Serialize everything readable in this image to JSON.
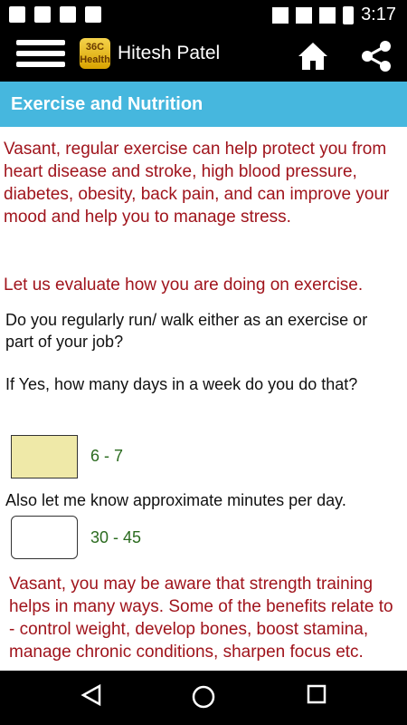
{
  "status_bar": {
    "time": "3:17"
  },
  "app_bar": {
    "logo_text_top": "36C",
    "logo_text_bottom": "Health",
    "title": "Hitesh Patel"
  },
  "section": {
    "title": "Exercise and Nutrition"
  },
  "content": {
    "intro": "Vasant, regular exercise can help protect you from heart disease and stroke, high blood pressure, diabetes, obesity, back pain, and can improve your mood and help you to manage stress.",
    "evaluate": "Let us evaluate how you are doing on exercise.",
    "question1": "Do you regularly run/ walk either as an exercise or part of your job?",
    "question2": "If Yes, how many days in a week do you do that?",
    "answer1": "6 - 7",
    "question3": "Also let me know approximate minutes per day.",
    "answer2": "30 - 45",
    "strength": "Vasant, you may be aware that strength training helps in many ways. Some of the benefits relate to - control weight, develop bones, boost stamina, manage chronic conditions, sharpen focus etc."
  },
  "colors": {
    "accent": "#46b7de",
    "message_red": "#a0141c",
    "answer_green": "#2b6b1f",
    "selected_box": "#efe9a8"
  }
}
